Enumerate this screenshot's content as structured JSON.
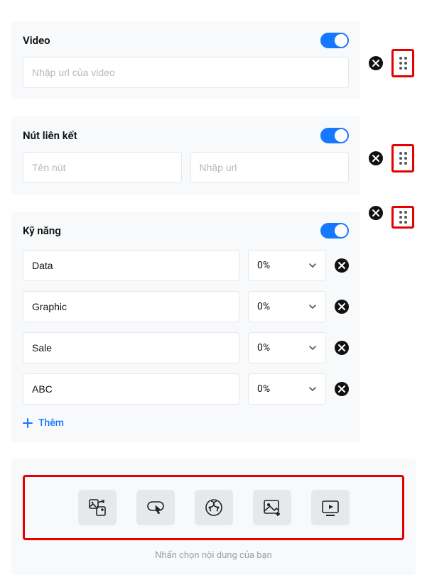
{
  "video": {
    "title": "Video",
    "placeholder": "Nhập url của video",
    "value": ""
  },
  "link_button": {
    "title": "Nút liên kết",
    "name_placeholder": "Tên nút",
    "url_placeholder": "Nhập url",
    "name_value": "",
    "url_value": ""
  },
  "skills": {
    "title": "Kỹ năng",
    "items": [
      {
        "name": "Data",
        "percent": "0%"
      },
      {
        "name": "Graphic",
        "percent": "0%"
      },
      {
        "name": "Sale",
        "percent": "0%"
      },
      {
        "name": "ABC",
        "percent": "0%"
      }
    ],
    "add_label": "Thêm"
  },
  "picker": {
    "caption": "Nhấn chọn nội dung của bạn"
  }
}
